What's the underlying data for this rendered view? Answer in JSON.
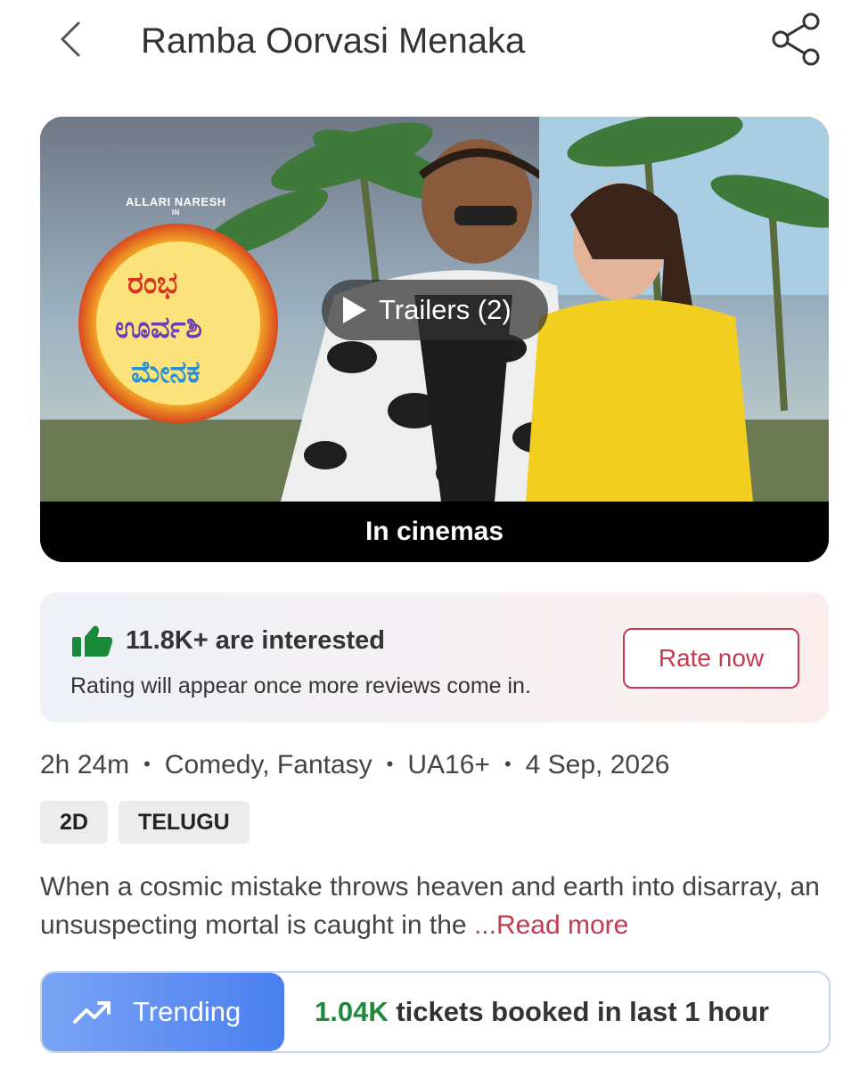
{
  "header": {
    "title": "Ramba Oorvasi Menaka",
    "back_icon": "chevron-left-icon",
    "share_icon": "share-icon"
  },
  "hero": {
    "artist_credit": "ALLARI NARESH",
    "artist_credit_suffix": "IN",
    "trailer_label": "Trailers (2)",
    "status_label": "In cinemas"
  },
  "interest": {
    "count_text": "11.8K+ are interested",
    "note": "Rating will appear once more reviews come in.",
    "rate_button": "Rate now",
    "icon": "thumbs-up-icon"
  },
  "meta": {
    "duration": "2h 24m",
    "genres": "Comedy, Fantasy",
    "certificate": "UA16+",
    "release_date": "4 Sep, 2026"
  },
  "tags": [
    "2D",
    "TELUGU"
  ],
  "synopsis": {
    "text": "When a cosmic mistake throws heaven and earth into disarray, an unsuspecting mortal is caught in the ",
    "read_more": "...Read more"
  },
  "trending": {
    "label": "Trending",
    "count": "1.04K",
    "text": " tickets booked in last 1 hour",
    "icon": "trending-up-icon"
  },
  "colors": {
    "accent_red": "#c43a4e",
    "trending_blue": "#4a7ff0",
    "count_green": "#1d8a3a",
    "thumb_green": "#1a8a3a"
  }
}
